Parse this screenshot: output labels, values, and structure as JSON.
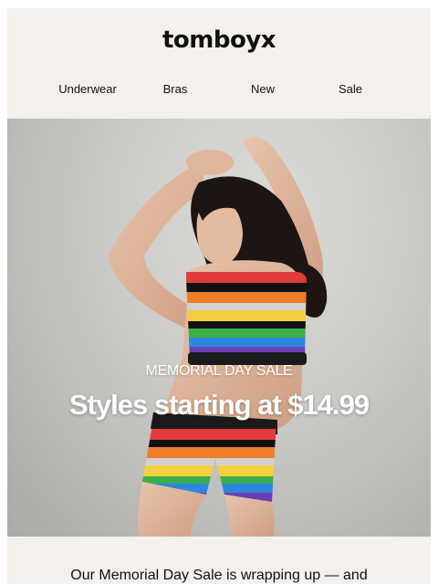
{
  "brand": {
    "logo": "tomboyx"
  },
  "nav": {
    "items": [
      {
        "label": "Underwear"
      },
      {
        "label": "Bras"
      },
      {
        "label": "New"
      },
      {
        "label": "Sale"
      }
    ]
  },
  "hero": {
    "eyebrow": "MEMORIAL DAY SALE",
    "headline": "Styles starting at $14.99"
  },
  "body": {
    "intro": "Our Memorial Day Sale is wrapping up — and"
  },
  "colors": {
    "background": "#f4f0ec",
    "text": "#111111",
    "hero_text": "#ffffff",
    "stripes": [
      "#e23b3b",
      "#f07d2a",
      "#f4d03f",
      "#3bb04a",
      "#2e86de",
      "#6a3fb5",
      "#d2d2d2",
      "#111111"
    ]
  }
}
